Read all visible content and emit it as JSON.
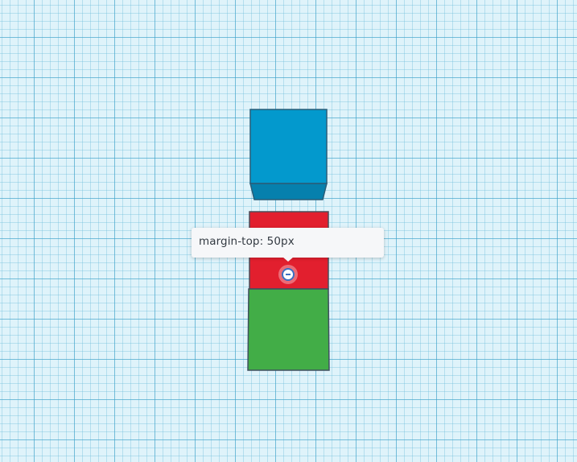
{
  "tooltip": {
    "text": "margin-top: 50px"
  },
  "colors": {
    "workplane": "#dff3fa",
    "grid_major": "#3ca0c8",
    "top_box": "#0399cd",
    "middle_box": "#e21f2e",
    "bottom_box": "#42ad47"
  },
  "icons": {
    "margin_handle": "minus-circle-icon"
  }
}
